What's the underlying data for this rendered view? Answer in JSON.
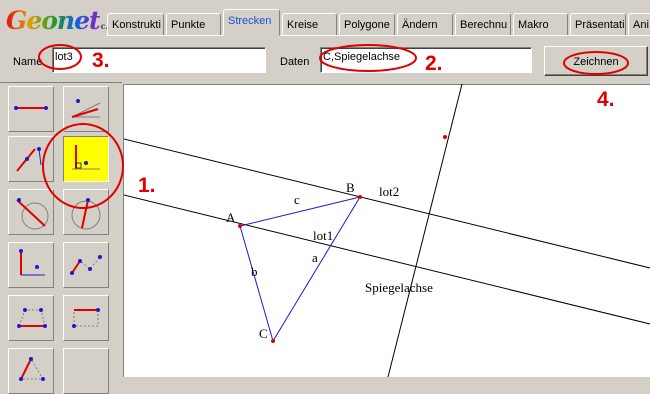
{
  "app": {
    "logo_text": "Geonet",
    "logo_suffix": "c.u."
  },
  "tabs": [
    {
      "label": "Konstrukti",
      "active": false
    },
    {
      "label": "Punkte",
      "active": false
    },
    {
      "label": "Strecken",
      "active": true
    },
    {
      "label": "Kreise",
      "active": false
    },
    {
      "label": "Polygone",
      "active": false
    },
    {
      "label": "Ändern",
      "active": false
    },
    {
      "label": "Berechnu",
      "active": false
    },
    {
      "label": "Makro",
      "active": false
    },
    {
      "label": "Präsentati",
      "active": false
    },
    {
      "label": "Ani",
      "active": false
    }
  ],
  "input_row": {
    "name_label": "Name",
    "name_value": "lot3",
    "data_label": "Daten",
    "data_value": "C,Spiegelachse",
    "draw_button": "Zeichnen"
  },
  "annotations": {
    "step1": "1.",
    "step2": "2.",
    "step3": "3.",
    "step4": "4."
  },
  "tools": [
    {
      "icon": "segment-icon",
      "selected": false
    },
    {
      "icon": "angle-bisector-icon",
      "selected": false
    },
    {
      "icon": "parallel-segment-icon",
      "selected": false
    },
    {
      "icon": "perpendicular-icon",
      "selected": true
    },
    {
      "icon": "circle-tangent-icon",
      "selected": false
    },
    {
      "icon": "circle-chord-icon",
      "selected": false
    },
    {
      "icon": "right-angle-icon",
      "selected": false
    },
    {
      "icon": "polyline-icon",
      "selected": false
    },
    {
      "icon": "quadrilateral-icon",
      "selected": false
    },
    {
      "icon": "rectangle-segment-icon",
      "selected": false
    },
    {
      "icon": "triangle-points-icon",
      "selected": false
    },
    {
      "icon": "empty-tool-icon",
      "selected": false
    }
  ],
  "geometry": {
    "points": [
      "A",
      "B",
      "C"
    ],
    "sides": [
      "a",
      "b",
      "c"
    ],
    "lines": [
      "lot1",
      "lot2",
      "Spiegelachse"
    ]
  },
  "colors": {
    "annotation": "#e00000",
    "segment": "#1a1ad0",
    "point": "#e00000",
    "selected_tool": "#ffff00",
    "active_tab_text": "#1a4fe0"
  }
}
